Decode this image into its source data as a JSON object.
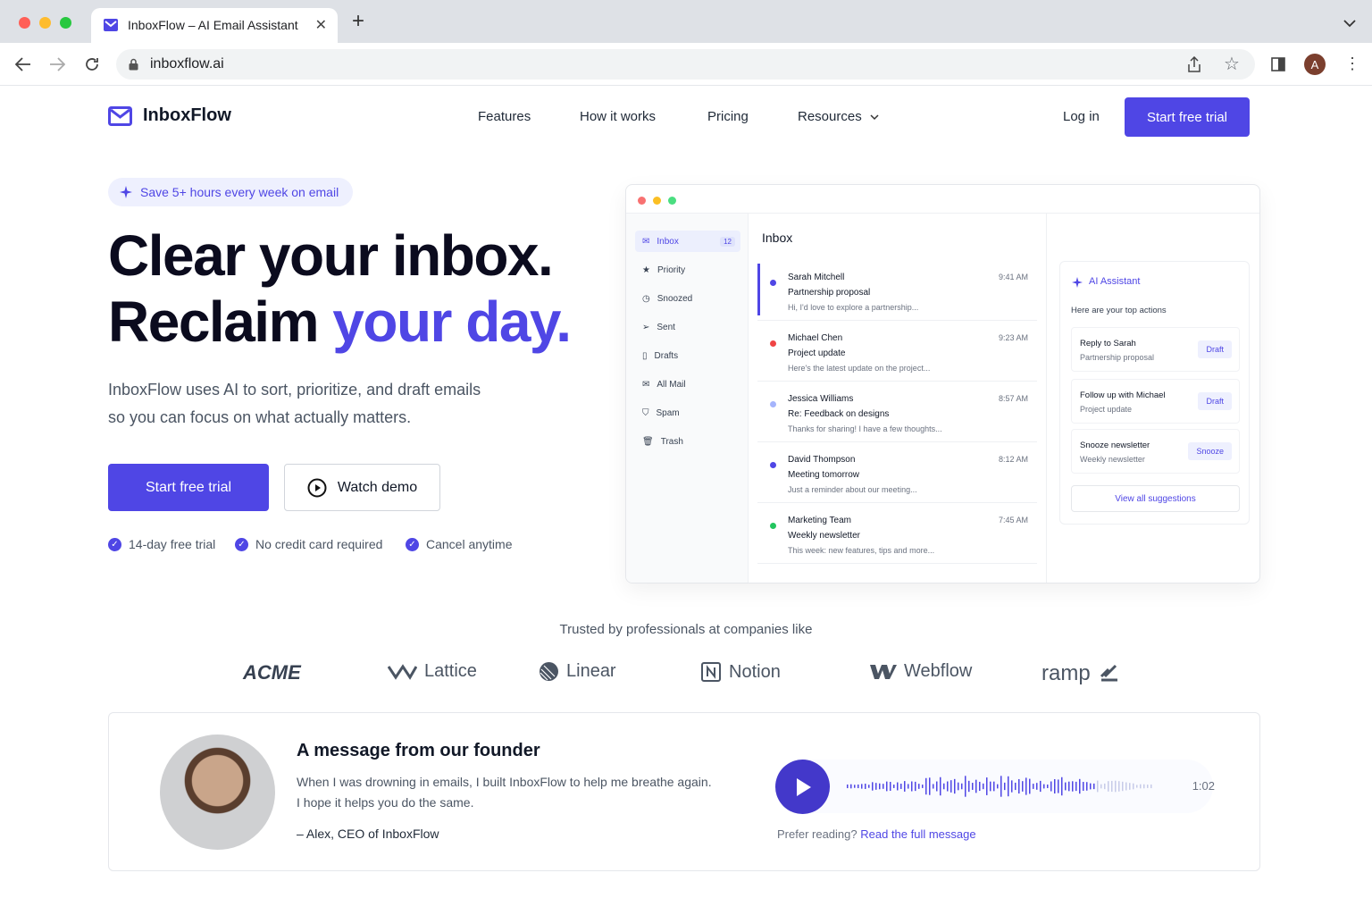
{
  "browser": {
    "tab_title": "InboxFlow – AI Email Assistant",
    "url": "inboxflow.ai",
    "profile_initial": "A"
  },
  "nav": {
    "brand": "InboxFlow",
    "links": [
      "Features",
      "How it works",
      "Pricing",
      "Resources"
    ],
    "login": "Log in",
    "cta": "Start free trial"
  },
  "hero": {
    "pill": "Save 5+ hours every week on email",
    "line1": "Clear your inbox.",
    "line2_plain": "Reclaim ",
    "line2_accent": "your day.",
    "sub1": "InboxFlow uses AI to sort, prioritize, and draft emails",
    "sub2": "so you can focus on what actually matters.",
    "primary_cta": "Start free trial",
    "secondary_cta": "Watch demo",
    "checks": [
      "14-day free trial",
      "No credit card required",
      "Cancel anytime"
    ]
  },
  "mockup": {
    "sidebar": [
      {
        "label": "Inbox",
        "icon": "mail-icon",
        "badge": "12"
      },
      {
        "label": "Priority",
        "icon": "star-icon"
      },
      {
        "label": "Snoozed",
        "icon": "clock-icon"
      },
      {
        "label": "Sent",
        "icon": "send-icon"
      },
      {
        "label": "Drafts",
        "icon": "file-icon"
      },
      {
        "label": "All Mail",
        "icon": "mail-icon"
      },
      {
        "label": "Spam",
        "icon": "shield-icon"
      },
      {
        "label": "Trash",
        "icon": "trash-icon"
      }
    ],
    "inbox_title": "Inbox",
    "emails": [
      {
        "from": "Sarah Mitchell",
        "subject": "Partnership proposal",
        "preview": "Hi, I'd love to explore a partnership...",
        "time": "9:41 AM",
        "dot": "#4f46e5"
      },
      {
        "from": "Michael Chen",
        "subject": "Project update",
        "preview": "Here's the latest update on the project...",
        "time": "9:23 AM",
        "dot": "#ef4444"
      },
      {
        "from": "Jessica Williams",
        "subject": "Re: Feedback on designs",
        "preview": "Thanks for sharing! I have a few thoughts...",
        "time": "8:57 AM",
        "dot": "#a5b4fc"
      },
      {
        "from": "David Thompson",
        "subject": "Meeting tomorrow",
        "preview": "Just a reminder about our meeting...",
        "time": "8:12 AM",
        "dot": "#4f46e5"
      },
      {
        "from": "Marketing Team",
        "subject": "Weekly newsletter",
        "preview": "This week: new features, tips and more...",
        "time": "7:45 AM",
        "dot": "#22c55e"
      }
    ],
    "ai": {
      "title": "AI Assistant",
      "subtitle": "Here are your top actions",
      "suggestions": [
        {
          "title": "Reply to Sarah",
          "detail": "Partnership proposal",
          "action": "Draft"
        },
        {
          "title": "Follow up with Michael",
          "detail": "Project update",
          "action": "Draft"
        },
        {
          "title": "Snooze newsletter",
          "detail": "Weekly newsletter",
          "action": "Snooze"
        }
      ],
      "view_all": "View all suggestions"
    }
  },
  "trusted": {
    "label": "Trusted by professionals at companies like",
    "logos": [
      "ACME",
      "Lattice",
      "Linear",
      "Notion",
      "Webflow",
      "ramp"
    ]
  },
  "founder": {
    "heading": "A message from our founder",
    "line1": "When I was drowning in emails, I built InboxFlow to help me breathe again.",
    "line2": "I hope it helps you do the same.",
    "signature": "– Alex, CEO of InboxFlow",
    "duration": "1:02",
    "prefer": "Prefer reading?",
    "read_link": "Read the full message"
  },
  "colors": {
    "accent": "#4f46e5",
    "text": "#111827"
  }
}
